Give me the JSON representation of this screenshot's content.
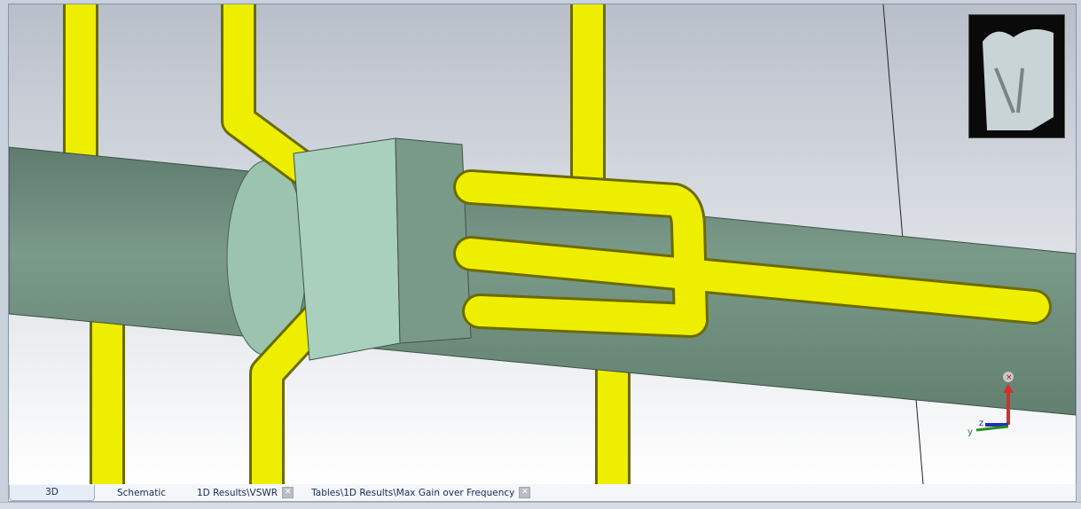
{
  "tabs": [
    {
      "label": "3D",
      "active": true,
      "closable": false
    },
    {
      "label": "Schematic",
      "active": false,
      "closable": false
    },
    {
      "label": "1D Results\\VSWR",
      "active": false,
      "closable": true
    },
    {
      "label": "Tables\\1D Results\\Max Gain over Frequency",
      "active": false,
      "closable": true
    }
  ],
  "axes": {
    "x": "x",
    "y": "y",
    "z": "z"
  },
  "colors": {
    "boom": "#6f8f80",
    "element": "#f0f000",
    "box_front": "#a8d0bc",
    "box_side": "#789888"
  }
}
